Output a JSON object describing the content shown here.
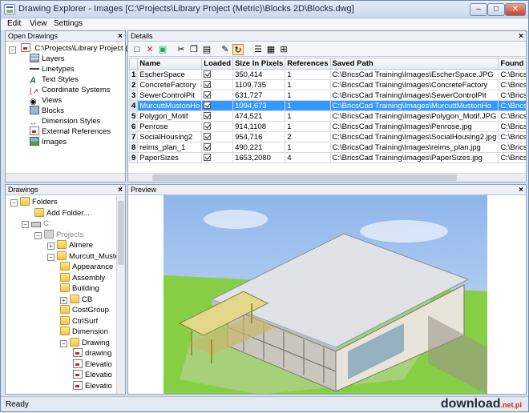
{
  "window": {
    "title": "Drawing Explorer - Images [C:\\Projects\\Library Project (Metric)\\Blocks 2D\\Blocks.dwg]"
  },
  "menu": [
    "Edit",
    "View",
    "Settings"
  ],
  "open_drawings": {
    "header": "Open Drawings",
    "root": "C:\\Projects\\Library Project (M",
    "items": [
      "Layers",
      "Linetypes",
      "Text Styles",
      "Coordinate Systems",
      "Views",
      "Blocks",
      "Dimension Styles",
      "External References",
      "Images"
    ]
  },
  "drawings": {
    "header": "Drawings",
    "rows": [
      {
        "label": "Folders",
        "icon": "folder-icon"
      },
      {
        "label": "Add Folder...",
        "icon": "folder-icon"
      },
      {
        "label": "C:",
        "icon": "drive-icon"
      },
      {
        "label": "Projects",
        "icon": "folder-icon"
      },
      {
        "label": "Almere",
        "icon": "folder-icon"
      },
      {
        "label": "Murcutt_Musto",
        "icon": "folder-icon"
      },
      {
        "label": "Appearance",
        "icon": "folder-icon"
      },
      {
        "label": "Assembly",
        "icon": "folder-icon"
      },
      {
        "label": "Building",
        "icon": "folder-icon"
      },
      {
        "label": "CB",
        "icon": "folder-icon"
      },
      {
        "label": "CostGroup",
        "icon": "folder-icon"
      },
      {
        "label": "CtrlSurf",
        "icon": "folder-icon"
      },
      {
        "label": "Dimension",
        "icon": "folder-icon"
      },
      {
        "label": "Drawing",
        "icon": "folder-icon"
      },
      {
        "label": "drawing",
        "icon": "drawing-file-icon"
      },
      {
        "label": "Elevatio",
        "icon": "drawing-file-icon"
      },
      {
        "label": "Elevatio",
        "icon": "drawing-file-icon"
      },
      {
        "label": "Elevatio",
        "icon": "drawing-file-icon"
      }
    ]
  },
  "details": {
    "header": "Details",
    "columns": [
      "",
      "Name",
      "Loaded",
      "Size In Pixels",
      "References",
      "Saved Path",
      "Found Path"
    ],
    "rows": [
      {
        "num": "1",
        "name": "EscherSpace",
        "size": "350,414",
        "refs": "1",
        "saved": "C:\\BricsCad Training\\Images\\EscherSpace.JPG",
        "found": "C:\\BricsCad Training\\"
      },
      {
        "num": "2",
        "name": "ConcreteFactory",
        "size": "1109,735",
        "refs": "1",
        "saved": "C:\\BricsCad Training\\Images\\ConcreteFactory",
        "found": "C:\\BricsCad Training\\"
      },
      {
        "num": "3",
        "name": "SewerControlPit",
        "size": "631,727",
        "refs": "1",
        "saved": "C:\\BricsCad Training\\Images\\SewerControlPit",
        "found": "C:\\BricsCad Training\\"
      },
      {
        "num": "4",
        "name": "MurcuttMustonHo",
        "size": "1094,673",
        "refs": "1",
        "saved": "C:\\BricsCad Training\\Images\\MurcuttMustonHo",
        "found": "C:\\BricsCad Training\\"
      },
      {
        "num": "5",
        "name": "Polygon_Motif",
        "size": "474,521",
        "refs": "1",
        "saved": "C:\\BricsCad Training\\Images\\Polygon_Motif.JPG",
        "found": "C:\\BricsCad Training\\"
      },
      {
        "num": "6",
        "name": "Penrose",
        "size": "914,1108",
        "refs": "1",
        "saved": "C:\\BricsCad Training\\Images\\Penrose.jpg",
        "found": "C:\\BricsCad Training\\"
      },
      {
        "num": "7",
        "name": "SocialHousing2",
        "size": "954,716",
        "refs": "2",
        "saved": "C:\\BricsCad Training\\Images\\SocialHousing2.jpg",
        "found": "C:\\BricsCad Training\\"
      },
      {
        "num": "8",
        "name": "reims_plan_1",
        "size": "490,221",
        "refs": "1",
        "saved": "C:\\BricsCad Training\\Images\\reims_plan.jpg",
        "found": "C:\\BricsCad Training\\"
      },
      {
        "num": "9",
        "name": "PaperSizes",
        "size": "1653,2080",
        "refs": "4",
        "saved": "C:\\BricsCad Training\\Images\\PaperSizes.jpg",
        "found": "C:\\BricsCad Training\\"
      }
    ],
    "selected_row": 4
  },
  "preview": {
    "header": "Preview"
  },
  "status": {
    "text": "Ready"
  },
  "watermark": {
    "brand": "download",
    "tld": ".net.pl"
  },
  "colors": {
    "selection": "#3399ff",
    "sky": "#a9c8f0",
    "lawn": "#8ad44a"
  }
}
